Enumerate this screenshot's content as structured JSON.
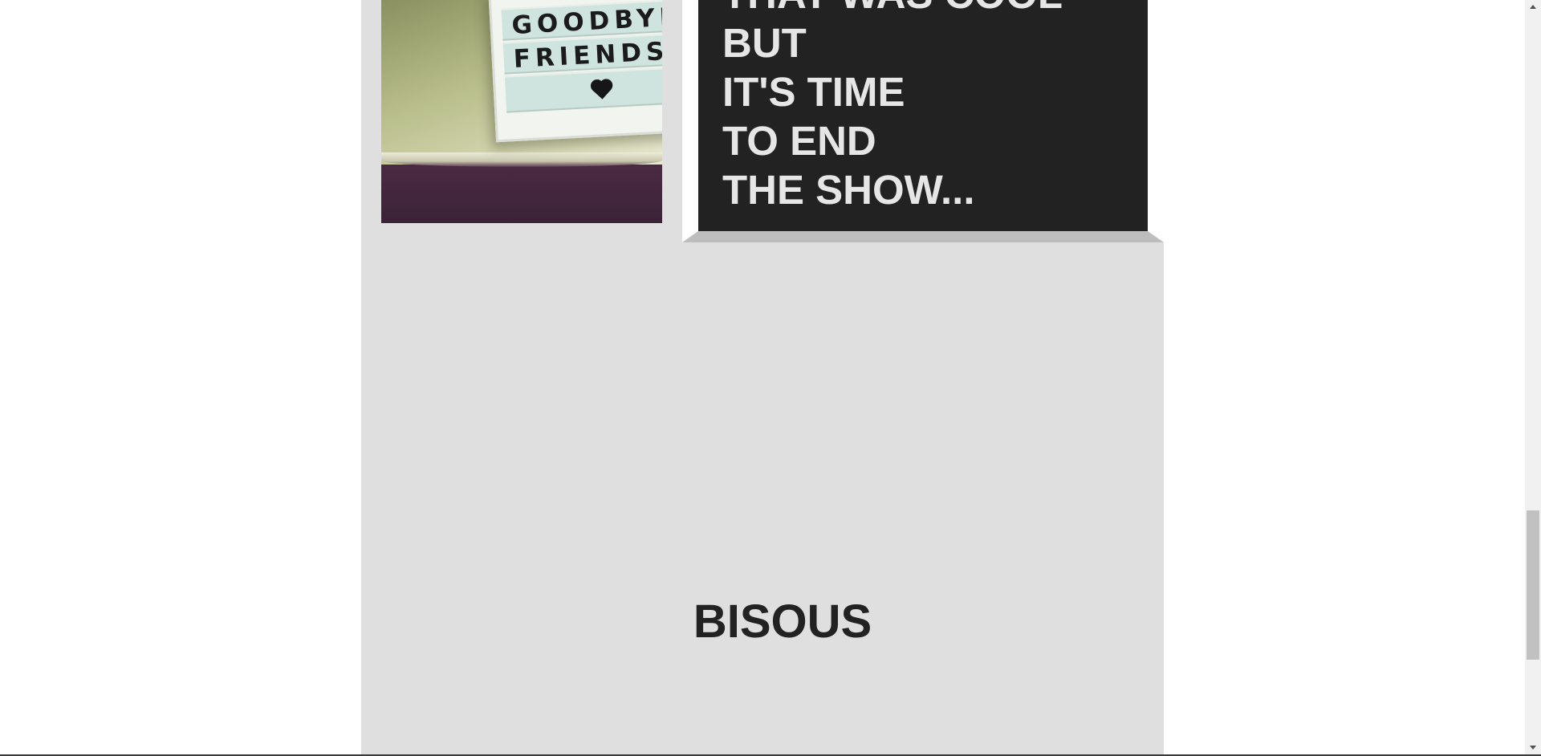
{
  "photo": {
    "sign_lines": [
      "GOODBYE",
      "FRIENDS"
    ],
    "heart": "heart-icon"
  },
  "card": {
    "lines": [
      "THAT WAS COOL",
      "BUT",
      "IT'S TIME",
      "TO END",
      "THE SHOW..."
    ]
  },
  "footer": {
    "text": "BISOUS"
  },
  "scrollbar": {
    "position_fraction": 0.86
  },
  "colors": {
    "page_bg": "#ffffff",
    "column_bg": "#dfdfdf",
    "card_bg": "#222222",
    "card_text": "#e6e6e6",
    "footer_text": "#222222"
  }
}
